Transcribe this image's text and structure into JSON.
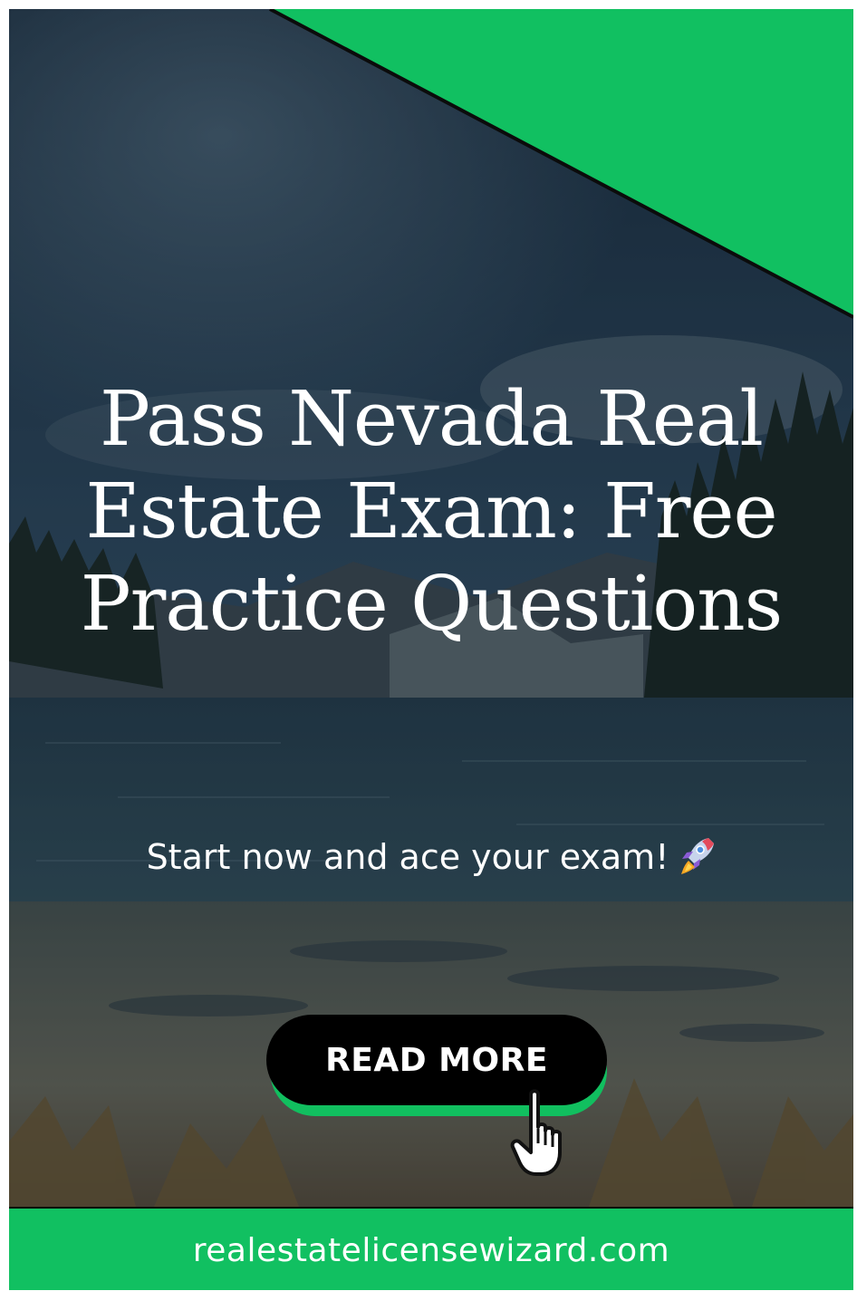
{
  "headline": "Pass Nevada Real Estate Exam: Free Practice Questions",
  "tagline": "Start now and ace your exam!",
  "cta": {
    "label": "READ MORE"
  },
  "footer": {
    "site": "realestatelicensewizard.com"
  },
  "icons": {
    "tagline": "rocket-icon",
    "cta": "pointing-hand-cursor-icon"
  },
  "colors": {
    "brand_green": "#11c061",
    "button": "#000000",
    "text": "#ffffff",
    "overlay_dark": "#24343f"
  }
}
